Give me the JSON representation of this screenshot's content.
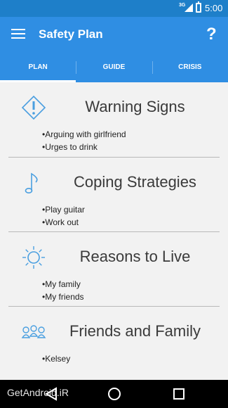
{
  "status_bar": {
    "network": "3G",
    "time": "5:00"
  },
  "app_bar": {
    "title": "Safety Plan",
    "help_label": "?"
  },
  "tabs": [
    {
      "label": "PLAN"
    },
    {
      "label": "GUIDE"
    },
    {
      "label": "CRISIS"
    }
  ],
  "sections": [
    {
      "title": "Warning Signs",
      "icon": "warning-diamond-icon",
      "items": [
        "Arguing with girlfriend",
        "Urges to drink"
      ]
    },
    {
      "title": "Coping Strategies",
      "icon": "music-note-icon",
      "items": [
        "Play guitar",
        "Work out"
      ]
    },
    {
      "title": "Reasons to Live",
      "icon": "sun-icon",
      "items": [
        "My family",
        "My friends"
      ]
    },
    {
      "title": "Friends and Family",
      "icon": "people-icon",
      "items": [
        "Kelsey"
      ]
    }
  ],
  "watermark": "GetAndroid.iR",
  "colors": {
    "app_bar": "#2f8ee3",
    "status_bar": "#1e7fc9",
    "icon": "#4a9fe0"
  }
}
